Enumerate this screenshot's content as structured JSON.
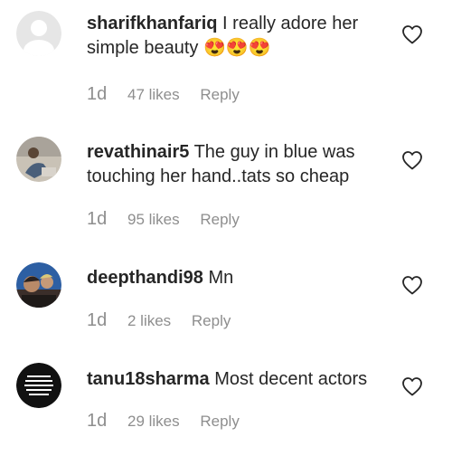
{
  "comments": [
    {
      "username": "sharifkhanfariq",
      "text": "I really adore her simple beauty 😍😍😍",
      "time": "1d",
      "likes": "47 likes",
      "reply": "Reply",
      "avatar": "default-avatar-icon"
    },
    {
      "username": "revathinair5",
      "text": "The guy in blue was touching her hand..tats so cheap",
      "time": "1d",
      "likes": "95 likes",
      "reply": "Reply",
      "avatar": "photo-avatar"
    },
    {
      "username": "deepthandi98",
      "text": "Mn",
      "time": "1d",
      "likes": "2 likes",
      "reply": "Reply",
      "avatar": "photo-avatar"
    },
    {
      "username": "tanu18sharma",
      "text": "Most decent actors",
      "time": "1d",
      "likes": "29 likes",
      "reply": "Reply",
      "avatar": "text-logo-avatar"
    }
  ],
  "colors": {
    "text": "#262626",
    "meta": "#8e8e8e",
    "heart_outline": "#262626"
  }
}
